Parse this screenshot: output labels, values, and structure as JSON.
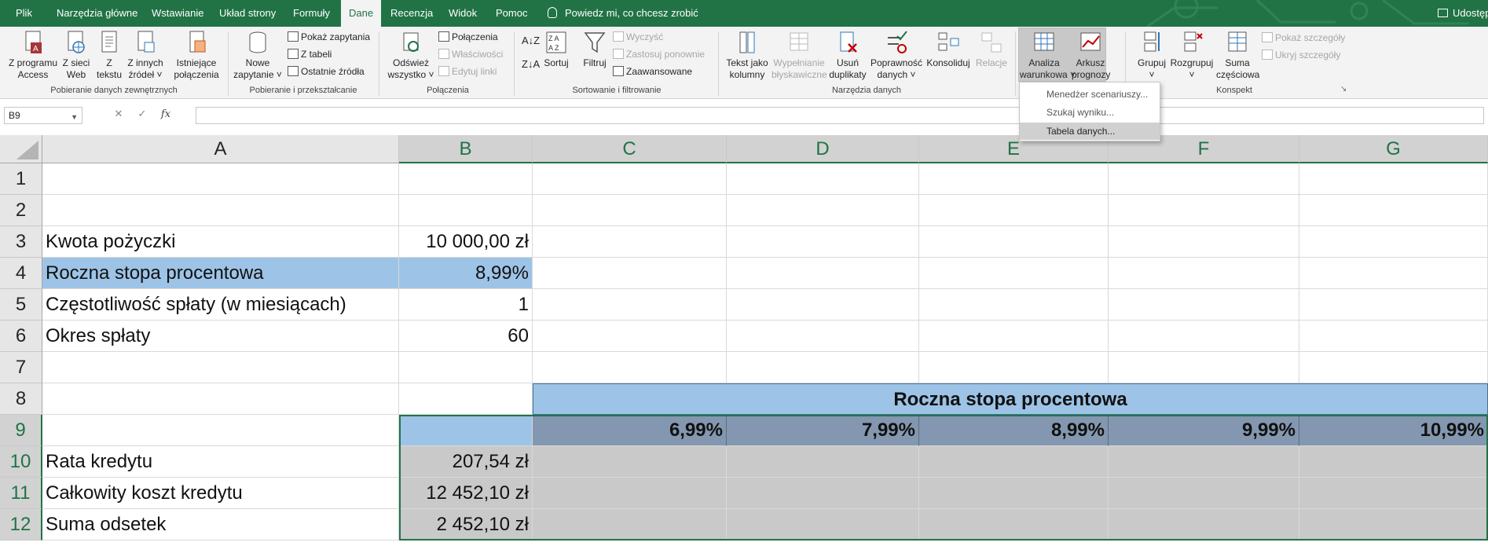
{
  "menu": {
    "tabs": [
      "Plik",
      "Narzędzia główne",
      "Wstawianie",
      "Układ strony",
      "Formuły",
      "Dane",
      "Recenzja",
      "Widok",
      "Pomoc"
    ],
    "active_tab": "Dane",
    "tell_me": "Powiedz mi, co chcesz zrobić",
    "share": "Udostępnij"
  },
  "ribbon": {
    "groups": {
      "get_external": "Pobieranie danych zewnętrznych",
      "transform": "Pobieranie i przekształcanie",
      "connections": "Połączenia",
      "sort_filter": "Sortowanie i filtrowanie",
      "data_tools": "Narzędzia danych",
      "outline": "Konspekt"
    },
    "buttons": {
      "access": [
        "Z programu",
        "Access"
      ],
      "web": [
        "Z sieci",
        "Web"
      ],
      "text": [
        "Z",
        "tekstu"
      ],
      "other": [
        "Z innych",
        "źródeł ˅"
      ],
      "existing": [
        "Istniejące",
        "połączenia"
      ],
      "new_query": [
        "Nowe",
        "zapytanie ˅"
      ],
      "show_queries": "Pokaż zapytania",
      "from_table": "Z tabeli",
      "recent_sources": "Ostatnie źródła",
      "refresh": [
        "Odśwież",
        "wszystko ˅"
      ],
      "connections": "Połączenia",
      "properties": "Właściwości",
      "edit_links": "Edytuj linki",
      "sort": "Sortuj",
      "filter": "Filtruj",
      "clear": "Wyczyść",
      "reapply": "Zastosuj ponownie",
      "advanced": "Zaawansowane",
      "text_to_columns": [
        "Tekst jako",
        "kolumny"
      ],
      "flash_fill": [
        "Wypełnianie",
        "błyskawiczne"
      ],
      "remove_duplicates": [
        "Usuń",
        "duplikaty"
      ],
      "validation": [
        "Poprawność",
        "danych ˅"
      ],
      "consolidate": "Konsoliduj",
      "relations": "Relacje",
      "what_if": [
        "Analiza",
        "warunkowa ˅"
      ],
      "forecast": [
        "Arkusz",
        "prognozy"
      ],
      "group": [
        "Grupuj",
        "˅"
      ],
      "ungroup": [
        "Rozgrupuj",
        "˅"
      ],
      "subtotal": [
        "Suma",
        "częściowa"
      ],
      "show_detail": "Pokaż szczegóły",
      "hide_detail": "Ukryj szczegóły"
    }
  },
  "what_if_menu": [
    "Menedżer scenariuszy...",
    "Szukaj wyniku...",
    "Tabela danych..."
  ],
  "formula_bar": {
    "name_box": "B9",
    "cancel": "✕",
    "enter": "✓",
    "fx": "fx",
    "content": ""
  },
  "columns": [
    "A",
    "B",
    "C",
    "D",
    "E",
    "F",
    "G"
  ],
  "rows": [
    "1",
    "2",
    "3",
    "4",
    "5",
    "6",
    "7",
    "8",
    "9",
    "10",
    "11",
    "12"
  ],
  "cells": {
    "A3": "Kwota pożyczki",
    "B3": "10 000,00 zł",
    "A4": "Roczna stopa procentowa",
    "B4": "8,99%",
    "A5": "Częstotliwość spłaty (w miesiącach)",
    "B5": "1",
    "A6": "Okres spłaty",
    "B6": "60",
    "C8": "Roczna stopa procentowa",
    "C9": "6,99%",
    "D9": "7,99%",
    "E9": "8,99%",
    "F9": "9,99%",
    "G9": "10,99%",
    "A10": "Rata kredytu",
    "B10": "207,54 zł",
    "A11": "Całkowity koszt kredytu",
    "B11": "12 452,10 zł",
    "A12": "Suma odsetek",
    "B12": "2 452,10 zł"
  },
  "colors": {
    "excel_green": "#217346",
    "light_blue": "#9dc3e6",
    "header_blue": "#8497b0",
    "selection_gray": "#c9c9c9"
  }
}
